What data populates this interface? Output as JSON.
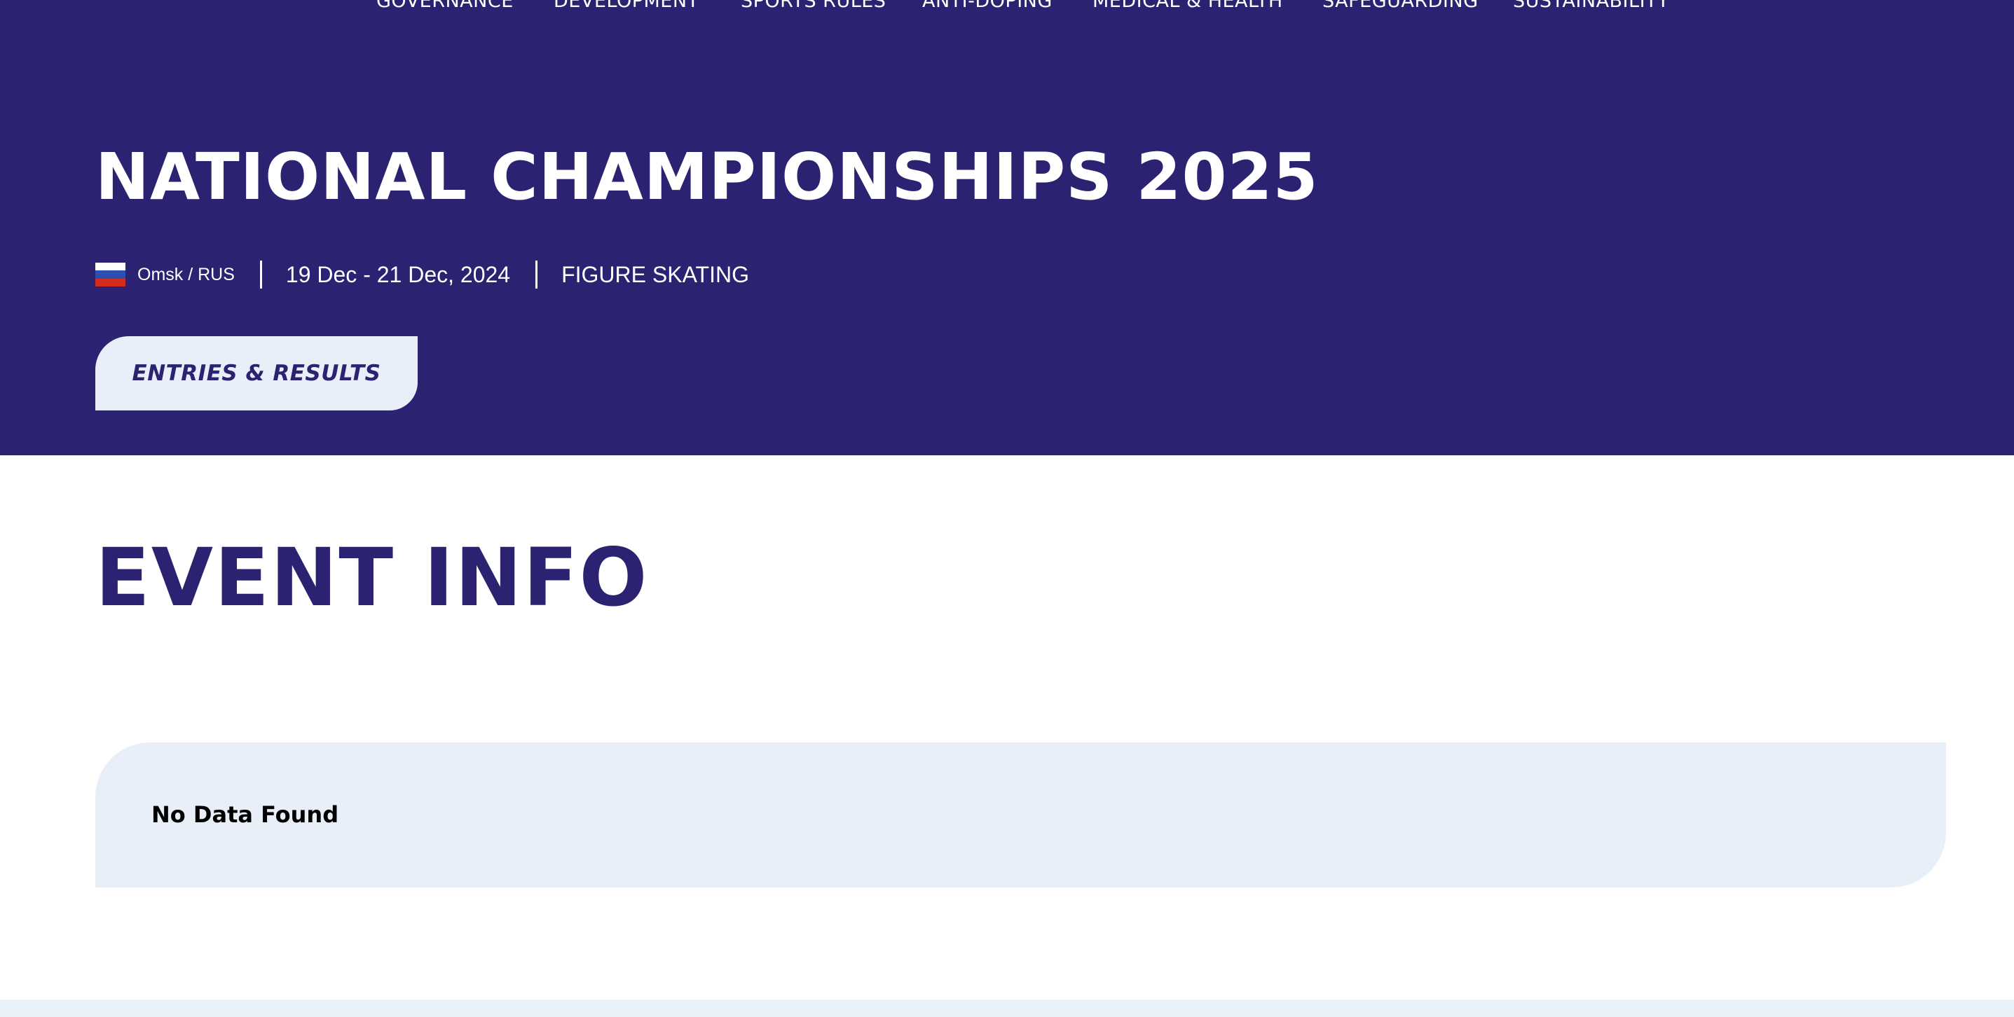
{
  "nav": {
    "items": [
      "GOVERNANCE",
      "DEVELOPMENT",
      "SPORTS RULES",
      "ANTI-DOPING",
      "MEDICAL & HEALTH",
      "SAFEGUARDING",
      "SUSTAINABILITY"
    ]
  },
  "event": {
    "title": "NATIONAL CHAMPIONSHIPS 2025",
    "flag_icon": "russia-flag-icon",
    "location": "Omsk / RUS",
    "dates": "19 Dec - 21 Dec, 2024",
    "sport": "FIGURE SKATING",
    "button_label": "ENTRIES & RESULTS"
  },
  "event_info": {
    "heading": "EVENT INFO",
    "empty_message": "No Data Found"
  },
  "colors": {
    "brand_purple": "#2b2272",
    "panel_light": "#e9eff8",
    "text_white": "#ffffff",
    "text_black": "#000000"
  }
}
